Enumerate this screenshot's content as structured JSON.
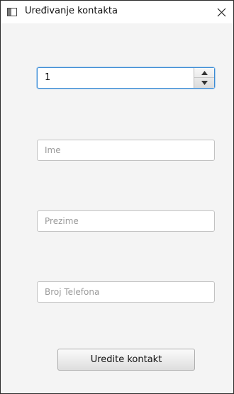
{
  "window": {
    "title": "Uređivanje kontakta",
    "icons": {
      "app": "window-app-icon",
      "close": "close-icon"
    }
  },
  "form": {
    "id_spinner": {
      "value": "1",
      "icons": {
        "up": "chevron-up-icon",
        "down": "chevron-down-icon"
      }
    },
    "name_field": {
      "value": "",
      "placeholder": "Ime"
    },
    "surname_field": {
      "value": "",
      "placeholder": "Prezime"
    },
    "phone_field": {
      "value": "",
      "placeholder": "Broj Telefona"
    },
    "submit_label": "Uredite kontakt"
  },
  "colors": {
    "focus_border": "#3a8ad3",
    "field_border": "#c2c2c2",
    "background": "#f4f4f4"
  }
}
